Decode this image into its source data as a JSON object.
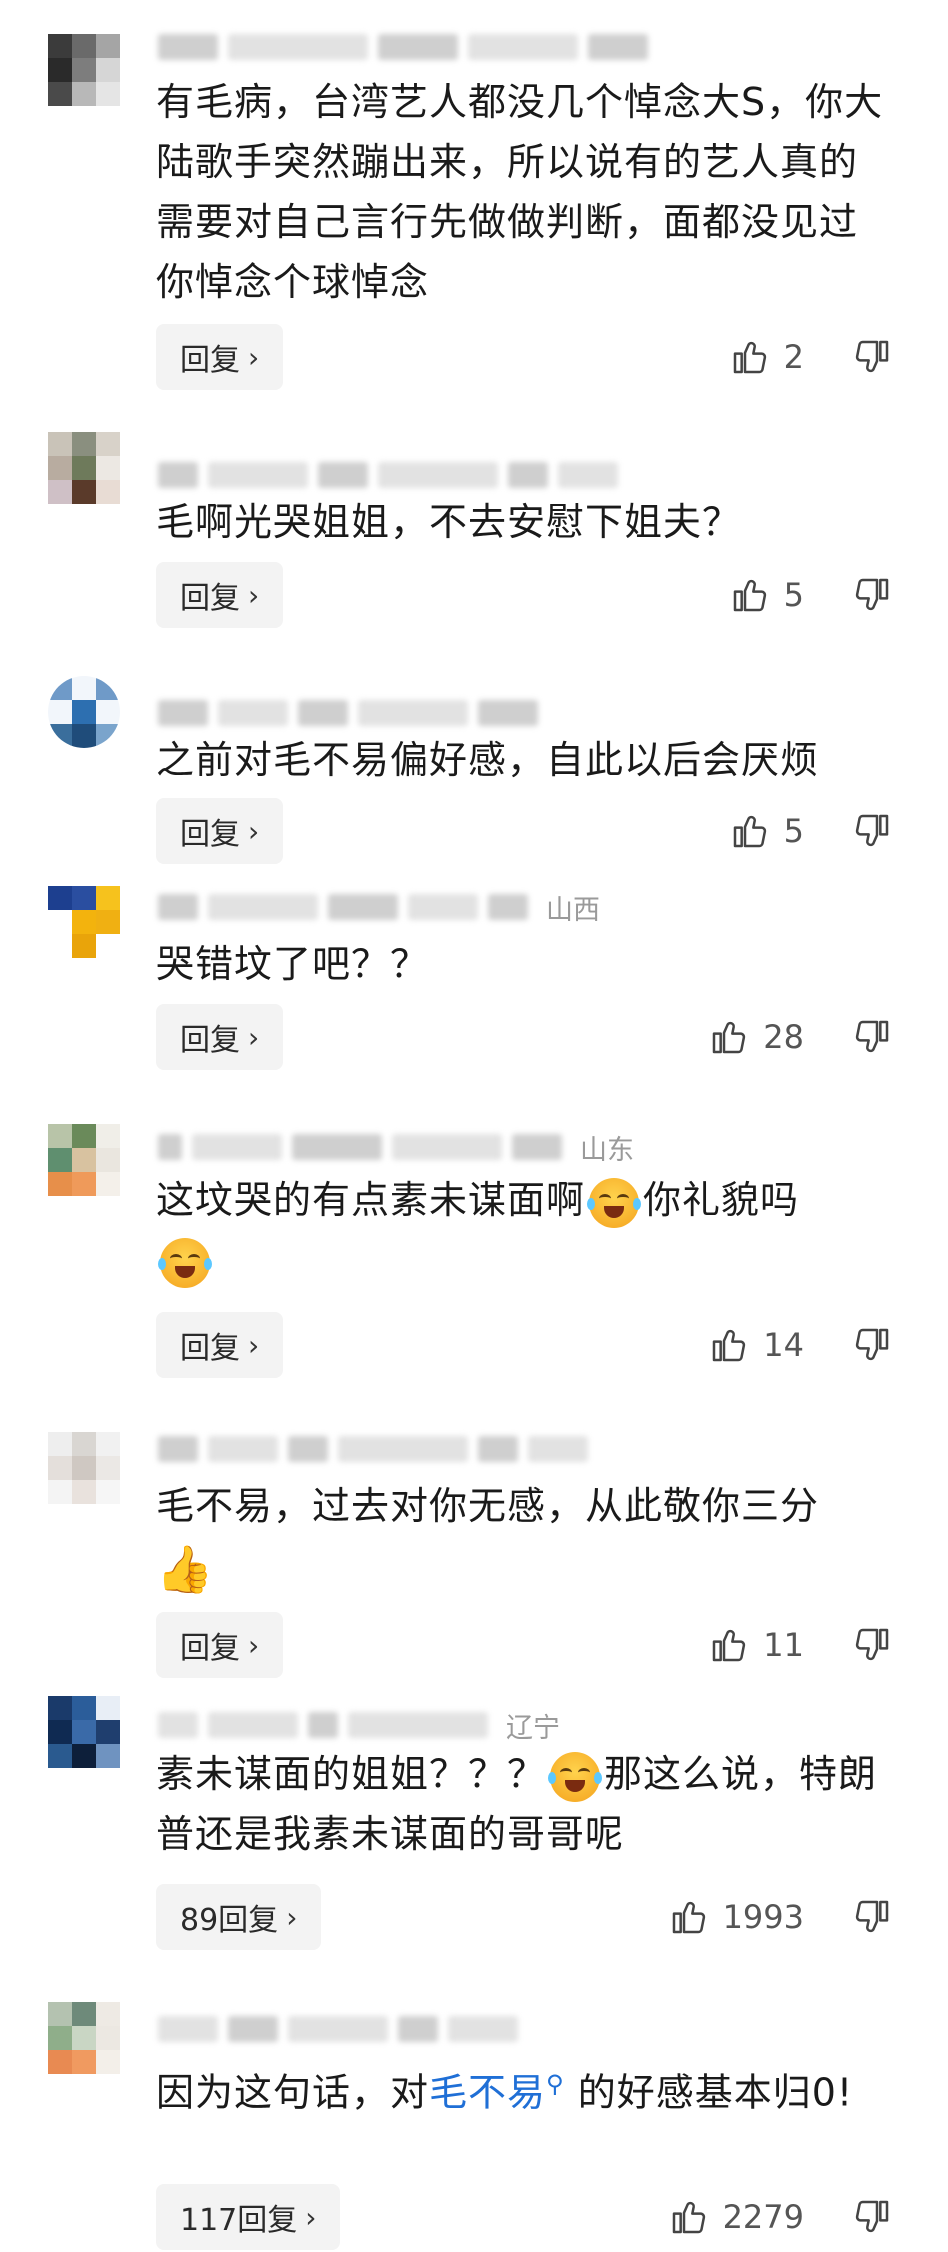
{
  "comments": [
    {
      "region": "",
      "text": "有毛病，台湾艺人都没几个悼念大S，你大陆歌手突然蹦出来，所以说有的艺人真的需要对自己言行先做做判断，面都没见过你悼念个球悼念",
      "reply": "回复",
      "likes": "2"
    },
    {
      "region": "",
      "text": "毛啊光哭姐姐，不去安慰下姐夫？",
      "reply": "回复",
      "likes": "5"
    },
    {
      "region": "",
      "text": "之前对毛不易偏好感，自此以后会厌烦",
      "reply": "回复",
      "likes": "5"
    },
    {
      "region": "山西",
      "text": "哭错坟了吧？？",
      "reply": "回复",
      "likes": "28"
    },
    {
      "region": "山东",
      "text_a": "这坟哭的有点素未谋面啊",
      "text_b": "你礼貌吗",
      "reply": "回复",
      "likes": "14"
    },
    {
      "region": "",
      "text": "毛不易，过去对你无感，从此敬你三分",
      "reply": "回复",
      "likes": "11"
    },
    {
      "region": "辽宁",
      "text_a": "素未谋面的姐姐？？？",
      "text_b": "那这么说，特朗普还是我素未谋面的哥哥呢",
      "reply": "89回复",
      "likes": "1993"
    },
    {
      "region": "",
      "text_a": "因为这句话，对",
      "link": "毛不易",
      "text_b": "的好感基本归0!",
      "reply": "117回复",
      "likes": "2279"
    }
  ],
  "icons": {
    "like": "thumb-up-icon",
    "dislike": "thumb-down-icon",
    "chevron": "chevron-right-icon",
    "search": "search-icon"
  }
}
